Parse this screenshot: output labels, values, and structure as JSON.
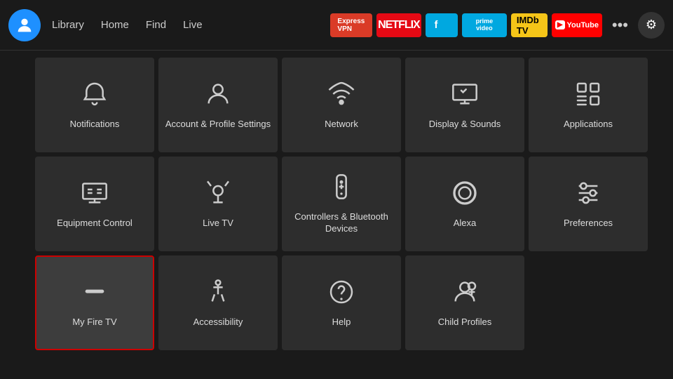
{
  "nav": {
    "links": [
      {
        "label": "Library",
        "name": "library"
      },
      {
        "label": "Home",
        "name": "home"
      },
      {
        "label": "Find",
        "name": "find"
      },
      {
        "label": "Live",
        "name": "live"
      }
    ],
    "apps": [
      {
        "label": "ExpressVPN",
        "class": "app-expressvpn",
        "name": "expressvpn-btn"
      },
      {
        "label": "NETFLIX",
        "class": "app-netflix",
        "name": "netflix-btn"
      },
      {
        "label": "▶",
        "class": "app-freevee",
        "name": "freevee-btn"
      },
      {
        "label": "prime video",
        "class": "app-prime",
        "name": "prime-btn"
      },
      {
        "label": "IMDb TV",
        "class": "app-imdb",
        "name": "imdb-btn"
      },
      {
        "label": "▶ YouTube",
        "class": "app-youtube",
        "name": "youtube-btn"
      }
    ],
    "more_label": "•••",
    "settings_icon": "⚙"
  },
  "tiles": [
    {
      "id": "notifications",
      "label": "Notifications",
      "icon": "bell",
      "selected": false
    },
    {
      "id": "account-profile",
      "label": "Account & Profile Settings",
      "icon": "person",
      "selected": false
    },
    {
      "id": "network",
      "label": "Network",
      "icon": "wifi",
      "selected": false
    },
    {
      "id": "display-sounds",
      "label": "Display & Sounds",
      "icon": "display",
      "selected": false
    },
    {
      "id": "applications",
      "label": "Applications",
      "icon": "apps",
      "selected": false
    },
    {
      "id": "equipment-control",
      "label": "Equipment Control",
      "icon": "monitor",
      "selected": false
    },
    {
      "id": "live-tv",
      "label": "Live TV",
      "icon": "antenna",
      "selected": false
    },
    {
      "id": "controllers-bluetooth",
      "label": "Controllers & Bluetooth Devices",
      "icon": "remote",
      "selected": false
    },
    {
      "id": "alexa",
      "label": "Alexa",
      "icon": "alexa",
      "selected": false
    },
    {
      "id": "preferences",
      "label": "Preferences",
      "icon": "sliders",
      "selected": false
    },
    {
      "id": "my-fire-tv",
      "label": "My Fire TV",
      "icon": "firetv",
      "selected": true
    },
    {
      "id": "accessibility",
      "label": "Accessibility",
      "icon": "accessibility",
      "selected": false
    },
    {
      "id": "help",
      "label": "Help",
      "icon": "help",
      "selected": false
    },
    {
      "id": "child-profiles",
      "label": "Child Profiles",
      "icon": "child",
      "selected": false
    }
  ]
}
